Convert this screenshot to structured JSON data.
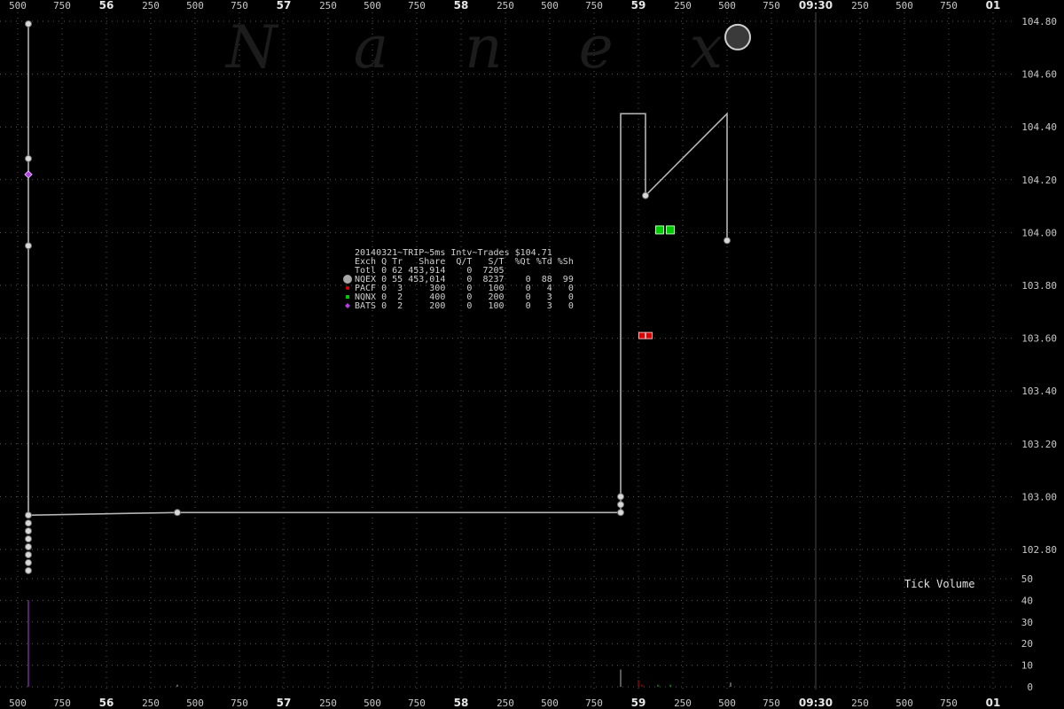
{
  "watermark": "Nanex",
  "legend": {
    "header": "20140321~TRIP~5ms Intv~Trades $104.71",
    "columns": "Exch Q Tr   Share  Q/T   S/T  %Qt %Td %Sh",
    "rows": [
      {
        "marker": "none",
        "color": "#d0d0d0",
        "text": "Totl 0 62 453,914    0  7205"
      },
      {
        "marker": "circle",
        "color": "#a8a8a8",
        "text": "NQEX 0 55 453,014    0  8237    0  88  99"
      },
      {
        "marker": "dot",
        "color": "#e00000",
        "text": "PACF 0  3     300    0   100    0   4   0"
      },
      {
        "marker": "square",
        "color": "#00cc00",
        "text": "NQNX 0  2     400    0   200    0   3   0"
      },
      {
        "marker": "diamond",
        "color": "#b040e0",
        "text": "BATS 0  2     200    0   100    0   3   0"
      }
    ]
  },
  "tick_volume_label": "Tick Volume",
  "chart_data": [
    {
      "type": "line",
      "title": "20140321~TRIP~5ms Intv~Trades $104.71",
      "x_tick_labels": [
        "500",
        "750",
        "56",
        "250",
        "500",
        "750",
        "57",
        "250",
        "500",
        "750",
        "58",
        "250",
        "500",
        "750",
        "59",
        "250",
        "500",
        "750",
        "09:30",
        "250",
        "500",
        "750",
        "01"
      ],
      "y_ticks": [
        "104.80",
        "104.60",
        "104.40",
        "104.20",
        "104.00",
        "103.80",
        "103.60",
        "103.40",
        "103.20",
        "103.00",
        "102.80"
      ],
      "ylim": [
        102.8,
        104.8
      ],
      "grid": true,
      "series": [
        {
          "name": "NQEX",
          "color": "#b4b4b4",
          "x": [
            55.56,
            55.56,
            55.56,
            55.56,
            55.56,
            55.56,
            56.4,
            58.9,
            58.9,
            58.9,
            59.04,
            59.04,
            59.5,
            59.5
          ],
          "y": [
            102.93,
            104.79,
            104.28,
            103.95,
            102.93,
            102.93,
            102.94,
            102.94,
            103.0,
            104.45,
            104.45,
            104.14,
            104.45,
            103.97
          ]
        }
      ],
      "markers": [
        {
          "exchange": "NQEX",
          "shape": "circle",
          "color": "#b4b4b4",
          "x": 55.56,
          "y": 104.79
        },
        {
          "exchange": "NQEX",
          "shape": "circle",
          "color": "#b4b4b4",
          "x": 55.56,
          "y": 104.28
        },
        {
          "exchange": "NQEX",
          "shape": "circle",
          "color": "#b4b4b4",
          "x": 55.56,
          "y": 103.95
        },
        {
          "exchange": "NQEX",
          "shape": "circle",
          "color": "#b4b4b4",
          "x": 55.56,
          "y": 102.93
        },
        {
          "exchange": "NQEX",
          "shape": "circle",
          "color": "#b4b4b4",
          "x": 55.56,
          "y": 102.9
        },
        {
          "exchange": "NQEX",
          "shape": "circle",
          "color": "#b4b4b4",
          "x": 55.56,
          "y": 102.87
        },
        {
          "exchange": "NQEX",
          "shape": "circle",
          "color": "#b4b4b4",
          "x": 55.56,
          "y": 102.84
        },
        {
          "exchange": "NQEX",
          "shape": "circle",
          "color": "#b4b4b4",
          "x": 55.56,
          "y": 102.81
        },
        {
          "exchange": "NQEX",
          "shape": "circle",
          "color": "#b4b4b4",
          "x": 55.56,
          "y": 102.78
        },
        {
          "exchange": "NQEX",
          "shape": "circle",
          "color": "#b4b4b4",
          "x": 55.56,
          "y": 102.75
        },
        {
          "exchange": "NQEX",
          "shape": "circle",
          "color": "#b4b4b4",
          "x": 55.56,
          "y": 102.72
        },
        {
          "exchange": "NQEX",
          "shape": "circle",
          "color": "#b4b4b4",
          "x": 56.4,
          "y": 102.94
        },
        {
          "exchange": "NQEX",
          "shape": "circle",
          "color": "#b4b4b4",
          "x": 58.9,
          "y": 102.94
        },
        {
          "exchange": "NQEX",
          "shape": "circle",
          "color": "#b4b4b4",
          "x": 58.9,
          "y": 102.97
        },
        {
          "exchange": "NQEX",
          "shape": "circle",
          "color": "#b4b4b4",
          "x": 58.9,
          "y": 103.0
        },
        {
          "exchange": "NQEX",
          "shape": "circle",
          "color": "#b4b4b4",
          "x": 59.04,
          "y": 104.14
        },
        {
          "exchange": "NQEX",
          "shape": "circle",
          "color": "#b4b4b4",
          "x": 59.5,
          "y": 103.97
        },
        {
          "exchange": "NQEX",
          "shape": "bigcircle",
          "color": "#3a3a3a",
          "x": 59.56,
          "y": 104.74
        },
        {
          "exchange": "BATS",
          "shape": "diamond",
          "color": "#b040e0",
          "x": 55.56,
          "y": 104.22
        },
        {
          "exchange": "PACF",
          "shape": "dot",
          "color": "#e00000",
          "x": 59.02,
          "y": 103.61
        },
        {
          "exchange": "PACF",
          "shape": "dot",
          "color": "#e00000",
          "x": 59.06,
          "y": 103.61
        },
        {
          "exchange": "NQNX",
          "shape": "square",
          "color": "#00cc00",
          "x": 59.12,
          "y": 104.01
        },
        {
          "exchange": "NQNX",
          "shape": "square",
          "color": "#00cc00",
          "x": 59.18,
          "y": 104.01
        }
      ]
    },
    {
      "type": "bar",
      "title": "Tick Volume",
      "y_ticks": [
        "50",
        "40",
        "30",
        "20",
        "10",
        "0"
      ],
      "ylim": [
        0,
        50
      ],
      "grid": true,
      "series": [
        {
          "name": "NQEX",
          "color": "#b0b0b0",
          "x": [
            55.56,
            56.4,
            58.9,
            59.0,
            59.52
          ],
          "values": [
            40,
            1,
            8,
            3,
            2
          ]
        },
        {
          "name": "BATS",
          "color": "#b040e0",
          "x": [
            55.56
          ],
          "values": [
            40
          ]
        },
        {
          "name": "PACF",
          "color": "#e00000",
          "x": [
            59.0,
            59.02
          ],
          "values": [
            3,
            1
          ]
        },
        {
          "name": "NQNX",
          "color": "#00cc00",
          "x": [
            59.11,
            59.18
          ],
          "values": [
            1,
            1
          ]
        }
      ]
    }
  ]
}
